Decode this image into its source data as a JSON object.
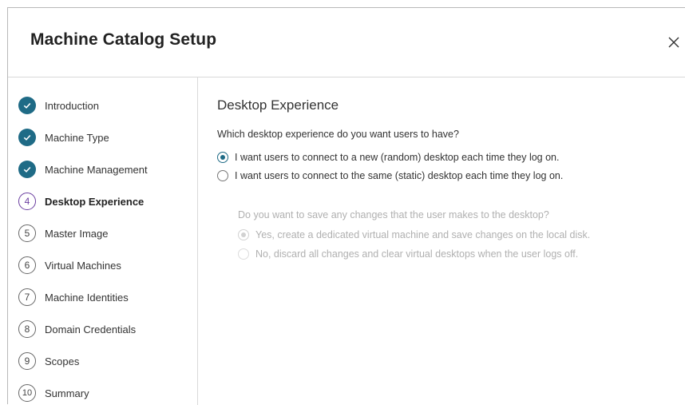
{
  "dialog": {
    "title": "Machine Catalog Setup",
    "close_icon": "close-icon"
  },
  "colors": {
    "accent": "#1f6b86",
    "current_step": "#6b3fa0",
    "disabled_text": "#b0b0b0"
  },
  "sidebar": {
    "steps": [
      {
        "marker": "",
        "label": "Introduction",
        "state": "done",
        "icon": "check-icon"
      },
      {
        "marker": "",
        "label": "Machine Type",
        "state": "done",
        "icon": "check-icon"
      },
      {
        "marker": "",
        "label": "Machine Management",
        "state": "done",
        "icon": "check-icon"
      },
      {
        "marker": "4",
        "label": "Desktop Experience",
        "state": "current"
      },
      {
        "marker": "5",
        "label": "Master Image",
        "state": "todo"
      },
      {
        "marker": "6",
        "label": "Virtual Machines",
        "state": "todo"
      },
      {
        "marker": "7",
        "label": "Machine Identities",
        "state": "todo"
      },
      {
        "marker": "8",
        "label": "Domain Credentials",
        "state": "todo"
      },
      {
        "marker": "9",
        "label": "Scopes",
        "state": "todo"
      },
      {
        "marker": "10",
        "label": "Summary",
        "state": "todo"
      }
    ]
  },
  "main": {
    "section_title": "Desktop Experience",
    "question": "Which desktop experience do you want users to have?",
    "options": [
      {
        "label": "I want users to connect to a new (random) desktop each time they log on.",
        "checked": true
      },
      {
        "label": "I want users to connect to the same (static) desktop each time they log on.",
        "checked": false
      }
    ],
    "sub_question": "Do you want to save any changes that the user makes to the desktop?",
    "sub_options": [
      {
        "label": "Yes, create a dedicated virtual machine and save changes on the local disk.",
        "checked": true,
        "disabled": true
      },
      {
        "label": "No, discard all changes and clear virtual desktops when the user logs off.",
        "checked": false,
        "disabled": true
      }
    ]
  }
}
